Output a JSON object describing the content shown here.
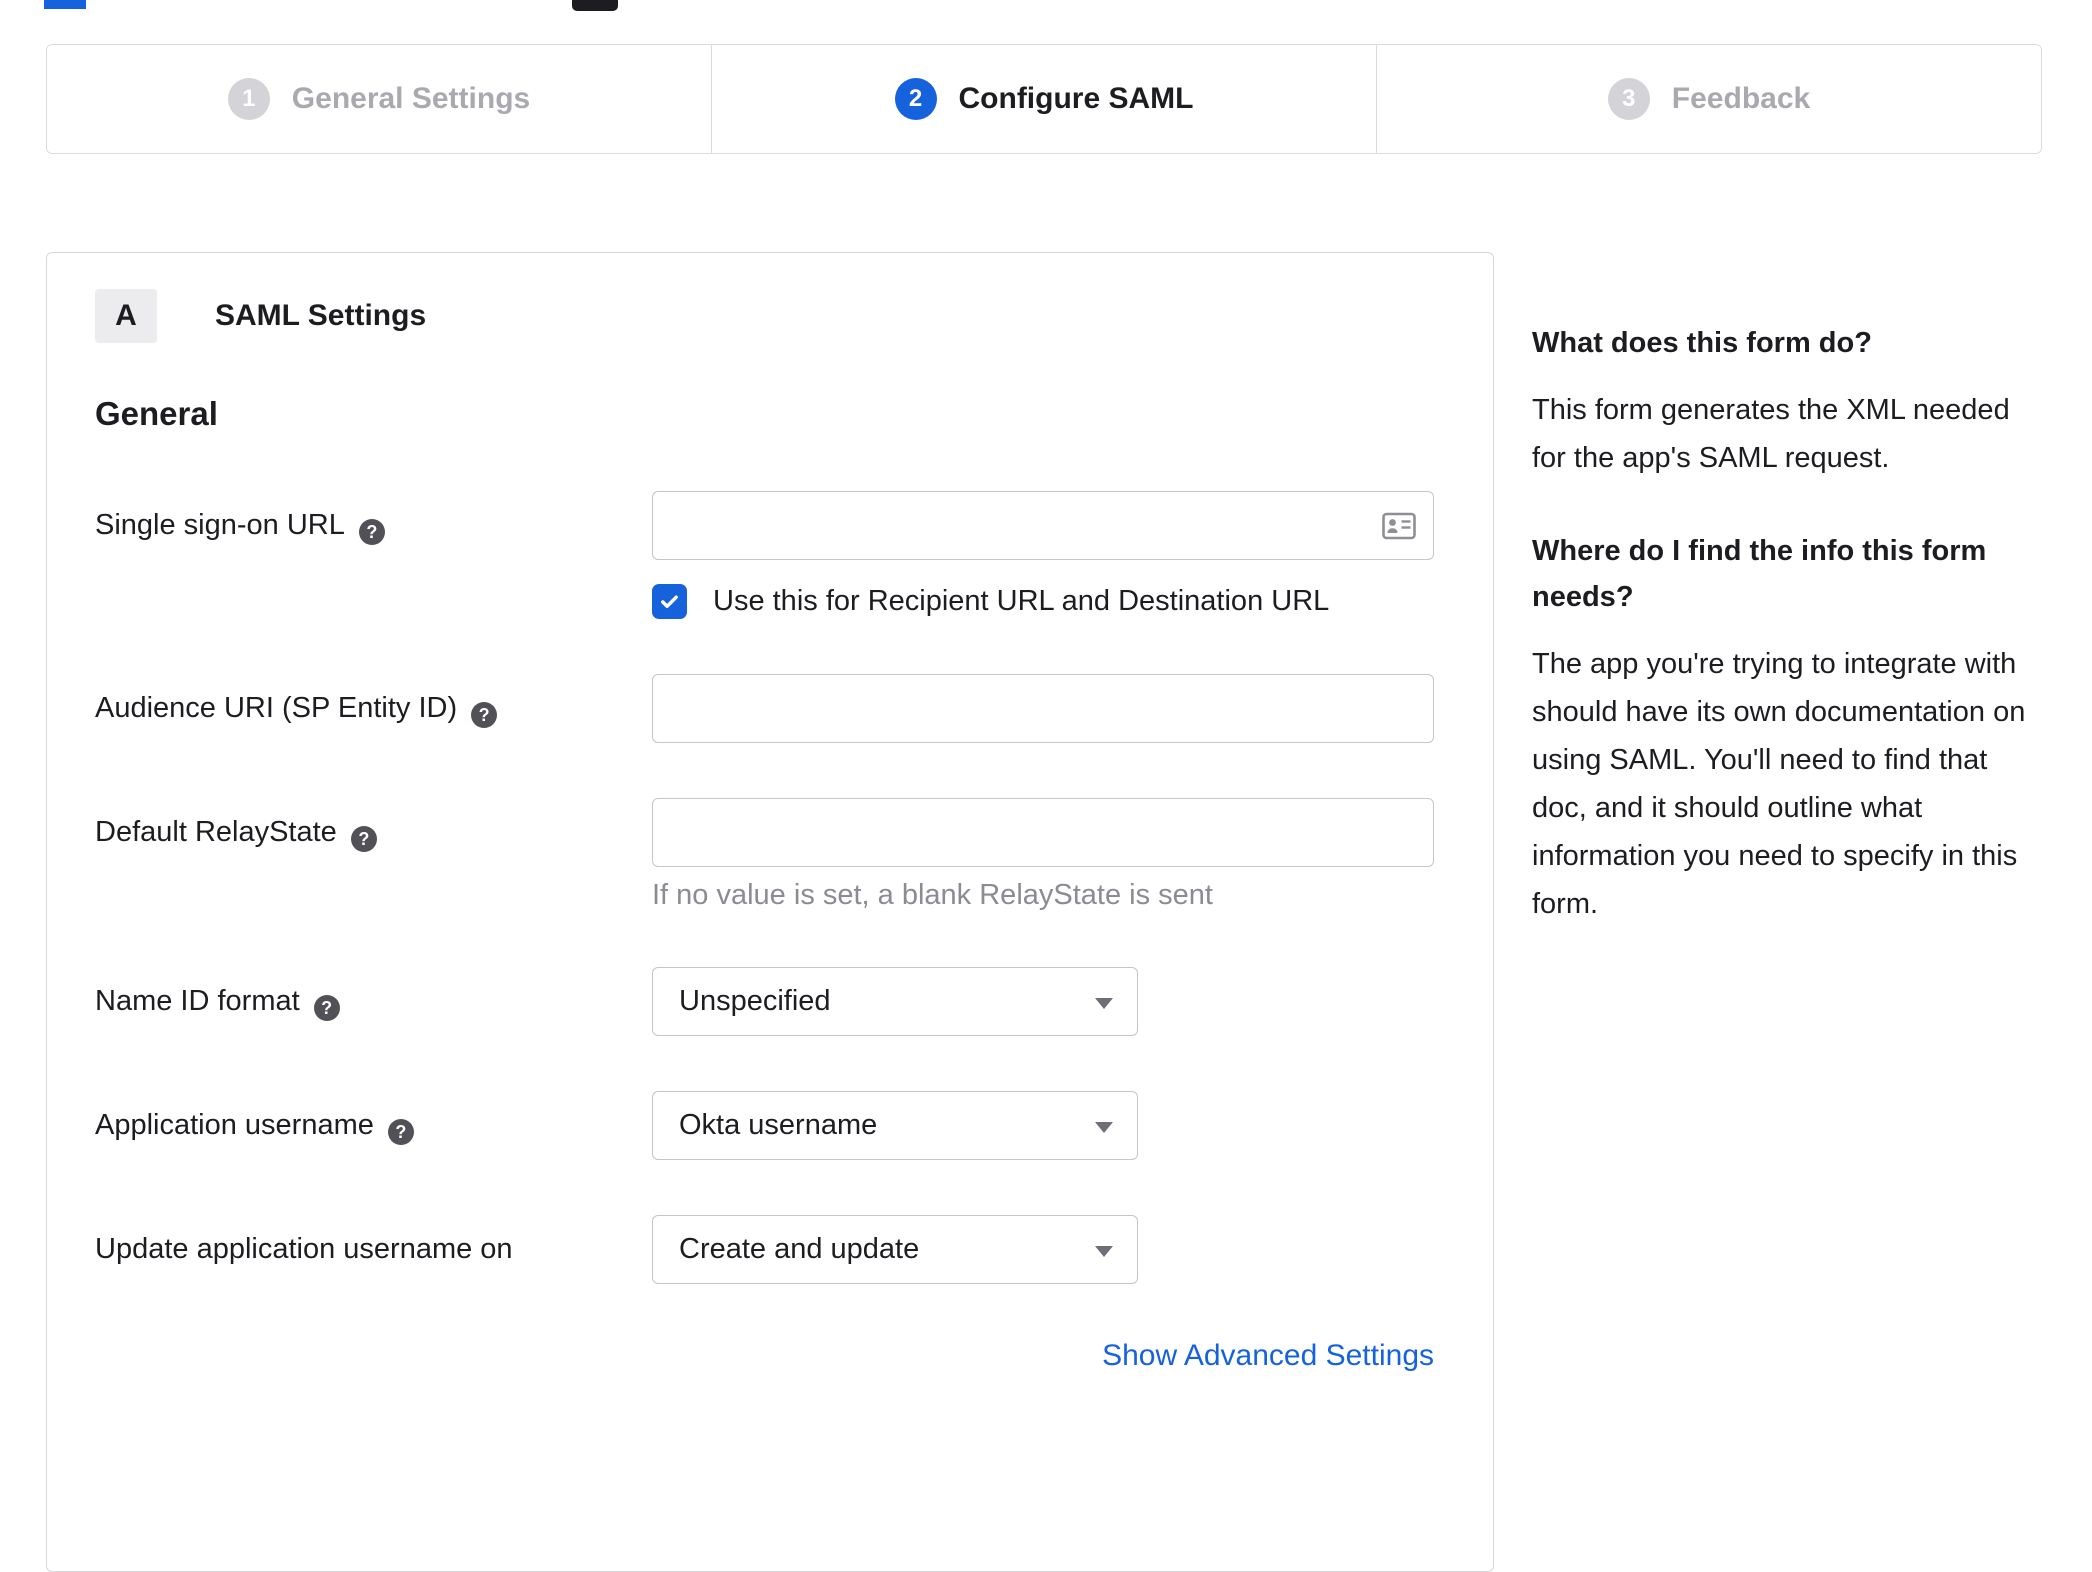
{
  "colors": {
    "accent": "#1662dd",
    "text": "#1d1d21",
    "inactive_label": "#a9a9af",
    "hint_text": "#8b8b93",
    "border": "#d8d8dc"
  },
  "stepper": {
    "steps": [
      {
        "number": "1",
        "label": "General Settings",
        "state": "inactive"
      },
      {
        "number": "2",
        "label": "Configure SAML",
        "state": "active"
      },
      {
        "number": "3",
        "label": "Feedback",
        "state": "inactive"
      }
    ]
  },
  "panel": {
    "badge": "A",
    "title": "SAML Settings",
    "group": "General",
    "sso": {
      "label": "Single sign-on URL",
      "value": "",
      "checkbox_label": "Use this for Recipient URL and Destination URL",
      "checked": true
    },
    "audience": {
      "label": "Audience URI (SP Entity ID)",
      "value": ""
    },
    "relay": {
      "label": "Default RelayState",
      "value": "",
      "hint": "If no value is set, a blank RelayState is sent"
    },
    "name_id": {
      "label": "Name ID format",
      "selected": "Unspecified"
    },
    "app_username": {
      "label": "Application username",
      "selected": "Okta username"
    },
    "update_username": {
      "label": "Update application username on",
      "selected": "Create and update"
    },
    "advanced_link": "Show Advanced Settings"
  },
  "sidebar": {
    "sections": [
      {
        "heading": "What does this form do?",
        "body": "This form generates the XML needed for the app's SAML request."
      },
      {
        "heading": "Where do I find the info this form needs?",
        "body": "The app you're trying to integrate with should have its own documentation on using SAML. You'll need to find that doc, and it should outline what information you need to specify in this form."
      }
    ]
  },
  "icons": {
    "help_glyph": "?",
    "sso_input_icon": "contact-card",
    "checkbox_icon": "checkmark",
    "select_icon": "caret-down"
  }
}
